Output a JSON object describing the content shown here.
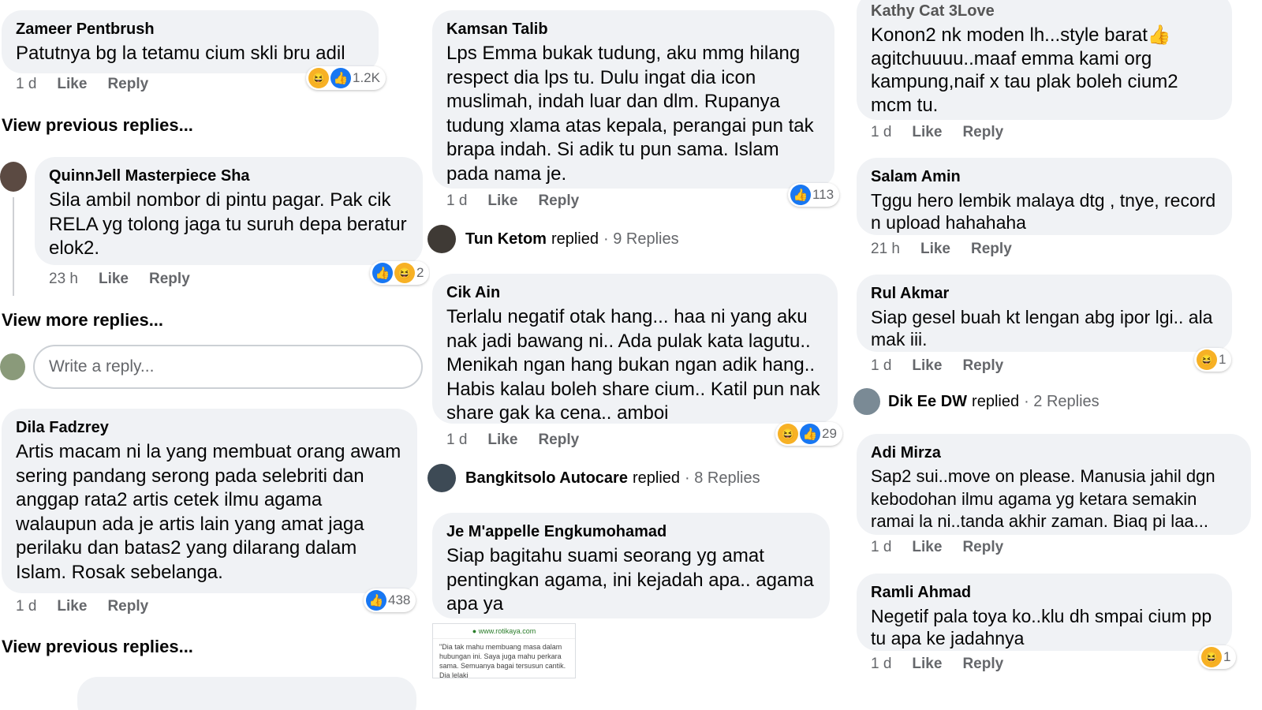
{
  "col1": {
    "c1": {
      "name": "Zameer Pentbrush",
      "text": "Patutnya bg la tetamu cium skli bru adil",
      "time": "1 d",
      "like": "Like",
      "reply": "Reply",
      "reactions": "1.2K"
    },
    "view1": "View previous replies...",
    "c2": {
      "name": "QuinnJell Masterpiece Sha",
      "text": "Sila ambil nombor di pintu pagar. Pak cik RELA yg tolong jaga tu suruh depa beratur elok2.",
      "time": "23 h",
      "like": "Like",
      "reply": "Reply",
      "reactions": "2"
    },
    "view2": "View more replies...",
    "write_placeholder": "Write a reply...",
    "c3": {
      "name": "Dila Fadzrey",
      "text": "Artis macam ni la yang membuat orang awam sering pandang serong pada selebriti dan anggap rata2 artis cetek ilmu agama walaupun ada je artis lain yang amat jaga perilaku dan batas2 yang dilarang dalam Islam. Rosak sebelanga.",
      "time": "1 d",
      "like": "Like",
      "reply": "Reply",
      "reactions": "438"
    },
    "view3": "View previous replies..."
  },
  "col2": {
    "c1": {
      "name": "Kamsan Talib",
      "text": "Lps Emma bukak tudung, aku mmg hilang respect dia lps tu. Dulu ingat dia icon muslimah, indah luar dan dlm. Rupanya tudung xlama atas kepala, perangai pun tak brapa indah. Si adik tu pun sama. Islam pada nama je.",
      "time": "1 d",
      "like": "Like",
      "reply": "Reply",
      "reactions": "113"
    },
    "r1": {
      "name": "Tun Ketom",
      "verb": "replied",
      "count": "· 9 Replies"
    },
    "c2": {
      "name": "Cik Ain",
      "text": "Terlalu negatif otak hang... haa ni yang aku nak jadi bawang ni.. Ada pulak kata lagutu.. Menikah ngan hang bukan ngan adik hang.. Habis kalau boleh share cium.. Katil pun nak share gak ka cena.. amboi",
      "time": "1 d",
      "like": "Like",
      "reply": "Reply",
      "reactions": "29"
    },
    "r2": {
      "name": "Bangkitsolo Autocare",
      "verb": "replied",
      "count": "· 8 Replies"
    },
    "c3": {
      "name": "Je M'appelle Engkumohamad",
      "text": "Siap bagitahu suami seorang yg amat pentingkan agama, ini kejadah apa.. agama apa ya"
    },
    "thumb": {
      "url": "www.rotikaya.com",
      "text": "\"Dia tak mahu membuang masa dalam hubungan ini. Saya juga mahu perkara sama. Semuanya bagai tersusun cantik. Dia lelaki"
    }
  },
  "col3": {
    "c1": {
      "name": "Kathy Cat 3Love",
      "text": "Konon2 nk moden lh...style barat👍 agitchuuuu..maaf emma kami org kampung,naif x tau plak boleh cium2 mcm tu.",
      "time": "1 d",
      "like": "Like",
      "reply": "Reply"
    },
    "c2": {
      "name": "Salam Amin",
      "text": "Tggu hero lembik malaya dtg , tnye, record n upload hahahaha",
      "time": "21 h",
      "like": "Like",
      "reply": "Reply"
    },
    "c3": {
      "name": "Rul Akmar",
      "text": "Siap gesel buah kt lengan abg ipor lgi.. ala mak iii.",
      "time": "1 d",
      "like": "Like",
      "reply": "Reply",
      "reactions": "1"
    },
    "r1": {
      "name": "Dik Ee DW",
      "verb": "replied",
      "count": "· 2 Replies"
    },
    "c4": {
      "name": "Adi Mirza",
      "text": "Sap2 sui..move on please. Manusia jahil dgn kebodohan ilmu agama yg ketara semakin ramai la ni..tanda akhir zaman. Biaq pi laa...",
      "time": "1 d",
      "like": "Like",
      "reply": "Reply"
    },
    "c5": {
      "name": "Ramli Ahmad",
      "text": "Negetif pala toya ko..klu dh smpai cium pp tu apa ke jadahnya",
      "time": "1 d",
      "like": "Like",
      "reply": "Reply",
      "reactions": "1"
    }
  },
  "icons": {
    "like": "like-reaction-icon",
    "haha": "haha-reaction-icon"
  },
  "colors": {
    "bubble": "#f0f2f5",
    "like_blue": "#1877f2",
    "meta_gray": "#65676b"
  }
}
